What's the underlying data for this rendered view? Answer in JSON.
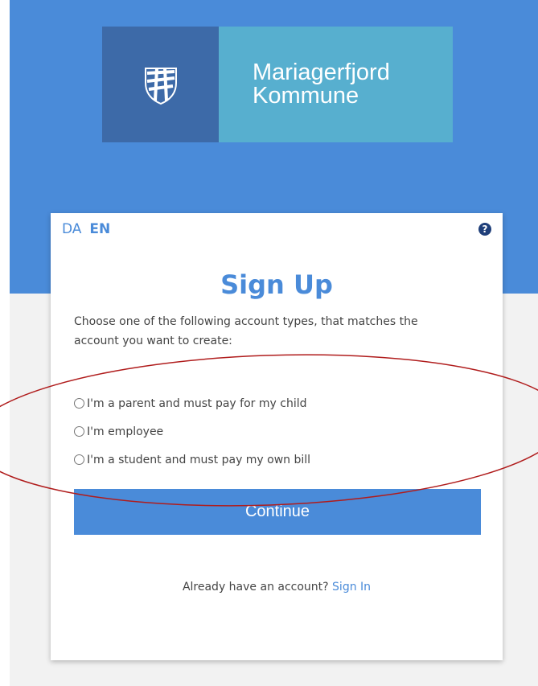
{
  "logo": {
    "line1": "Mariagerfjord",
    "line2": "Kommune",
    "emblem_icon": "municipal-shield-icon"
  },
  "language": {
    "da": "DA",
    "en": "EN",
    "active": "EN"
  },
  "help_icon": "question-circle-icon",
  "title": "Sign Up",
  "intro": "Choose one of the following account types, that matches the account you want to create:",
  "options": [
    {
      "label": "I'm a parent and must pay for my child",
      "checked": false
    },
    {
      "label": "I'm employee",
      "checked": false
    },
    {
      "label": "I'm a student and must pay my own bill",
      "checked": false
    }
  ],
  "continue_label": "Continue",
  "signin": {
    "prompt": "Already have an account?",
    "link": "Sign In"
  },
  "colors": {
    "brand_blue": "#4a8bd9",
    "emblem_bg": "#3d6aa8",
    "logo_text_bg": "#57afcf",
    "annotation_red": "#b01c1c"
  }
}
